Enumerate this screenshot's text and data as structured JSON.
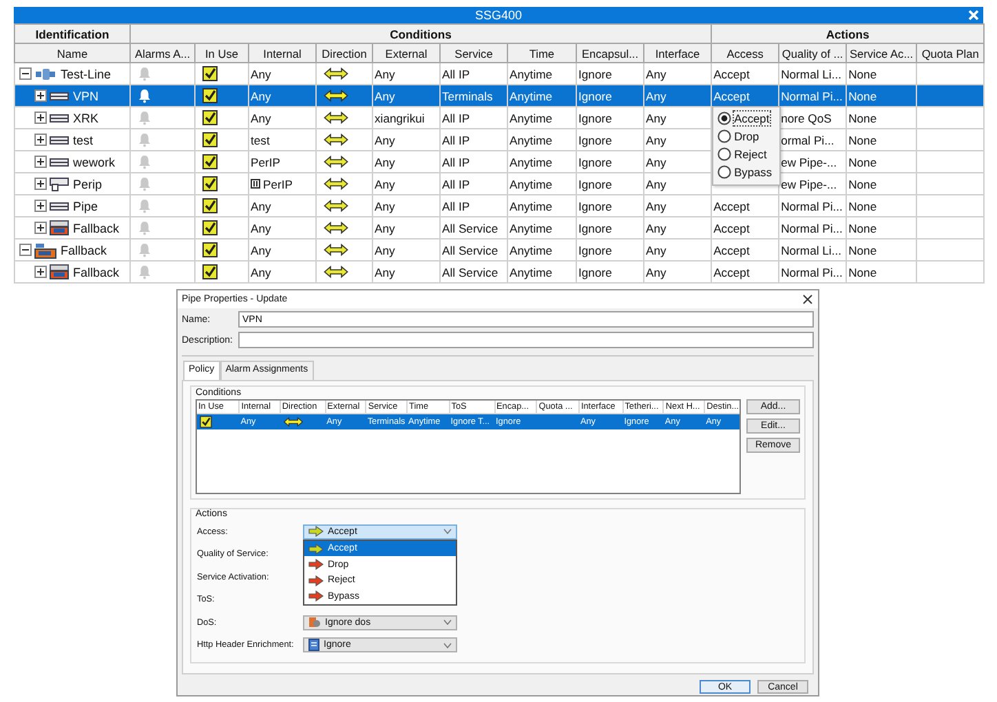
{
  "main_window": {
    "title": "SSG400",
    "groups": [
      {
        "label": "Identification",
        "columns": [
          {
            "label": "Name",
            "kind": "tree"
          }
        ]
      },
      {
        "label": "Conditions",
        "columns": [
          {
            "label": "Alarms A...",
            "kind": "alarm"
          },
          {
            "label": "In Use",
            "kind": "check"
          },
          {
            "label": "Internal",
            "kind": "internal"
          },
          {
            "label": "Direction",
            "kind": "direction"
          },
          {
            "label": "External",
            "kind": "external"
          },
          {
            "label": "Service",
            "kind": "service"
          },
          {
            "label": "Time",
            "kind": "time"
          },
          {
            "label": "Encapsul...",
            "kind": "encapsulation"
          },
          {
            "label": "Interface",
            "kind": "interface"
          }
        ]
      },
      {
        "label": "Actions",
        "columns": [
          {
            "label": "Access",
            "kind": "access"
          },
          {
            "label": "Quality of ...",
            "kind": "quality"
          },
          {
            "label": "Service Ac...",
            "kind": "service_activation"
          },
          {
            "label": "Quota Plan",
            "kind": "quota_plan"
          }
        ]
      }
    ],
    "rows": [
      {
        "name": "Test-Line",
        "kind": "line",
        "expanded": true,
        "selected": false,
        "in_use": true,
        "internal": "Any",
        "external": "Any",
        "service": "All IP",
        "time": "Anytime",
        "encapsulation": "Ignore",
        "interface": "Any",
        "access": "Accept",
        "quality": "Normal Li...",
        "service_activation": "None",
        "children": [
          {
            "name": "VPN",
            "kind": "pipe",
            "expanded": false,
            "selected": true,
            "in_use": true,
            "internal": "Any",
            "external": "Any",
            "service": "Terminals",
            "time": "Anytime",
            "encapsulation": "Ignore",
            "interface": "Any",
            "access": "Accept",
            "quality": "Normal Pi...",
            "service_activation": "None",
            "menu": [
              {
                "label": "Accept",
                "selected": true
              },
              {
                "label": "Drop",
                "selected": false
              },
              {
                "label": "Reject",
                "selected": false
              },
              {
                "label": "Bypass",
                "selected": false
              }
            ]
          },
          {
            "name": "XRK",
            "kind": "pipe",
            "expanded": false,
            "selected": false,
            "in_use": true,
            "internal": "Any",
            "external": "xiangrikui",
            "service": "All IP",
            "time": "Anytime",
            "encapsulation": "Ignore",
            "interface": "Any",
            "quality": "nore QoS",
            "service_activation": "None"
          },
          {
            "name": "test",
            "kind": "pipe",
            "expanded": false,
            "selected": false,
            "in_use": true,
            "internal": "test",
            "external": "Any",
            "service": "All IP",
            "time": "Anytime",
            "encapsulation": "Ignore",
            "interface": "Any",
            "quality": "ormal Pi...",
            "service_activation": "None"
          },
          {
            "name": "wework",
            "kind": "pipe",
            "expanded": false,
            "selected": false,
            "in_use": true,
            "internal": "PerIP",
            "external": "Any",
            "service": "All IP",
            "time": "Anytime",
            "encapsulation": "Ignore",
            "interface": "Any",
            "quality": "ew Pipe-...",
            "service_activation": "None"
          },
          {
            "name": "Perip",
            "kind": "pipe-group",
            "expanded": false,
            "selected": false,
            "in_use": true,
            "internal_group": true,
            "internal": "PerIP",
            "external": "Any",
            "service": "All IP",
            "time": "Anytime",
            "encapsulation": "Ignore",
            "interface": "Any",
            "quality": "ew Pipe-...",
            "service_activation": "None"
          },
          {
            "name": "Pipe",
            "kind": "pipe",
            "expanded": false,
            "selected": false,
            "in_use": true,
            "internal": "Any",
            "external": "Any",
            "service": "All IP",
            "time": "Anytime",
            "encapsulation": "Ignore",
            "interface": "Any",
            "access": "Accept",
            "quality": "Normal Pi...",
            "service_activation": "None"
          },
          {
            "name": "Fallback",
            "kind": "fallback",
            "expanded": false,
            "selected": false,
            "in_use": true,
            "internal": "Any",
            "external": "Any",
            "service": "All Service",
            "time": "Anytime",
            "encapsulation": "Ignore",
            "interface": "Any",
            "access": "Accept",
            "quality": "Normal Pi...",
            "service_activation": "None"
          }
        ]
      },
      {
        "name": "Fallback",
        "kind": "root-fallback",
        "expanded": true,
        "selected": false,
        "in_use": true,
        "internal": "Any",
        "external": "Any",
        "service": "All Service",
        "time": "Anytime",
        "encapsulation": "Ignore",
        "interface": "Any",
        "access": "Accept",
        "quality": "Normal Li...",
        "service_activation": "None",
        "children": [
          {
            "name": "Fallback",
            "kind": "fallback",
            "expanded": false,
            "selected": false,
            "in_use": true,
            "internal": "Any",
            "external": "Any",
            "service": "All Service",
            "time": "Anytime",
            "encapsulation": "Ignore",
            "interface": "Any",
            "access": "Accept",
            "quality": "Normal Pi...",
            "service_activation": "None"
          }
        ]
      }
    ]
  },
  "dialog": {
    "title": "Pipe Properties - Update",
    "fields": [
      {
        "label": "Name:",
        "value": "VPN"
      },
      {
        "label": "Description:"
      }
    ],
    "tabs": [
      {
        "label": "Policy",
        "selected": true
      },
      {
        "label": "Alarm Assignments",
        "selected": false
      }
    ],
    "conditions": {
      "title": "Conditions",
      "columns": [
        {
          "label": "In Use",
          "kind": "check"
        },
        {
          "label": "Internal",
          "kind": "internal"
        },
        {
          "label": "Direction",
          "kind": "direction"
        },
        {
          "label": "External",
          "kind": "external"
        },
        {
          "label": "Service",
          "kind": "service"
        },
        {
          "label": "Time",
          "kind": "time"
        },
        {
          "label": "ToS",
          "kind": "tos"
        },
        {
          "label": "Encap...",
          "kind": "encapsulation"
        },
        {
          "label": "Quota ...",
          "kind": "quota"
        },
        {
          "label": "Interface",
          "kind": "interface"
        },
        {
          "label": "Tetheri...",
          "kind": "tethering"
        },
        {
          "label": "Next H...",
          "kind": "next_hop"
        },
        {
          "label": "Destin...",
          "kind": "destination"
        }
      ],
      "rows": [
        {
          "selected": true,
          "in_use": true,
          "internal": "Any",
          "external": "Any",
          "service": "Terminals",
          "time": "Anytime",
          "tos": "Ignore T...",
          "encapsulation": "Ignore",
          "interface": "Any",
          "tethering": "Ignore",
          "next_hop": "Any",
          "destination": "Any"
        }
      ],
      "buttons": [
        "Add...",
        "Edit...",
        "Remove"
      ]
    },
    "actions": {
      "title": "Actions",
      "rows": [
        {
          "label": "Access:",
          "kind": "access",
          "value": "Accept",
          "open": true,
          "options": [
            {
              "label": "Accept",
              "selected": true,
              "color": "#c8d820"
            },
            {
              "label": "Drop",
              "selected": false,
              "color": "#e04020"
            },
            {
              "label": "Reject",
              "selected": false,
              "color": "#e04020"
            },
            {
              "label": "Bypass",
              "selected": false,
              "color": "#e04020"
            }
          ]
        },
        {
          "label": "Quality of Service:",
          "kind": "covered"
        },
        {
          "label": "Service Activation:",
          "kind": "covered"
        },
        {
          "label": "ToS:",
          "kind": "covered"
        },
        {
          "label": "DoS:",
          "kind": "dos",
          "value": "Ignore dos",
          "open": false
        },
        {
          "label": "Http Header Enrichment:",
          "kind": "header",
          "value": "Ignore",
          "open": false
        }
      ]
    },
    "buttons": [
      {
        "label": "OK",
        "default": true
      },
      {
        "label": "Cancel",
        "default": false
      }
    ]
  }
}
